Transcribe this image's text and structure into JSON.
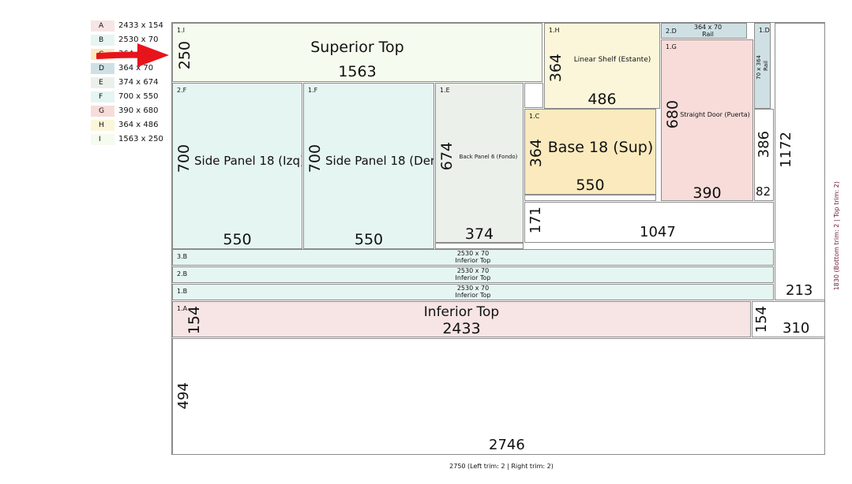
{
  "legend": [
    {
      "letter": "A",
      "dims": "2433 x 154",
      "color": "#f7e4e4"
    },
    {
      "letter": "B",
      "dims": "2530 x 70",
      "color": "#e5f5f2"
    },
    {
      "letter": "C",
      "dims": "364 x 550",
      "color": "#fbeabe"
    },
    {
      "letter": "D",
      "dims": "364 x 70",
      "color": "#cfe0e4"
    },
    {
      "letter": "E",
      "dims": "374 x 674",
      "color": "#ecf0eb"
    },
    {
      "letter": "F",
      "dims": "700 x 550",
      "color": "#e5f5f2"
    },
    {
      "letter": "G",
      "dims": "390 x 680",
      "color": "#f7dcd9"
    },
    {
      "letter": "H",
      "dims": "364 x 486",
      "color": "#fbf6d9"
    },
    {
      "letter": "I",
      "dims": "1563 x 250",
      "color": "#f5fbee"
    }
  ],
  "pieces": {
    "superior_top": {
      "code": "1.I",
      "name": "Superior Top",
      "width": "1563",
      "height": "250",
      "color": "#f5fbee"
    },
    "linear_shelf": {
      "code": "1.H",
      "name": "Linear Shelf (Estante)",
      "width": "486",
      "height": "364",
      "color": "#fbf6d9"
    },
    "rail_d2": {
      "code": "2.D",
      "dims": "364 x 70",
      "name": "Rail",
      "color": "#cfe0e4"
    },
    "rail_d1": {
      "code": "1.D",
      "dims": "70 x 364",
      "name": "Rail",
      "color": "#cfe0e4"
    },
    "straight_door": {
      "code": "1.G",
      "name": "Straight Door (Puerta)",
      "width": "390",
      "height": "680",
      "color": "#f7dcd9"
    },
    "side_panel_izq": {
      "code": "2.F",
      "name": "Side Panel 18 (Izq)",
      "width": "550",
      "height": "700",
      "color": "#e5f5f2"
    },
    "side_panel_der": {
      "code": "1.F",
      "name": "Side Panel 18 (Der)",
      "width": "550",
      "height": "700",
      "color": "#e5f5f2"
    },
    "back_panel": {
      "code": "1.E",
      "name": "Back Panel 6 (Fondo)",
      "width": "374",
      "height": "674",
      "color": "#ecf0eb"
    },
    "base_sup": {
      "code": "1.C",
      "name": "Base 18 (Sup)",
      "width": "550",
      "height": "364",
      "color": "#fbeabe"
    },
    "inferior_3b": {
      "code": "3.B",
      "dims": "2530 x 70",
      "name": "Inferior Top",
      "color": "#e5f5f2"
    },
    "inferior_2b": {
      "code": "2.B",
      "dims": "2530 x 70",
      "name": "Inferior Top",
      "color": "#e5f5f2"
    },
    "inferior_1b": {
      "code": "1.B",
      "dims": "2530 x 70",
      "name": "Inferior Top",
      "color": "#e5f5f2"
    },
    "inferior_top": {
      "code": "1.A",
      "name": "Inferior Top",
      "width": "2433",
      "height": "154",
      "color": "#f7e4e4"
    }
  },
  "waste": {
    "w1047": "1047",
    "h171": "171",
    "h386": "386",
    "w82": "82",
    "h1172": "1172",
    "w213": "213",
    "h154": "154",
    "w310": "310",
    "h494": "494",
    "w2746": "2746"
  },
  "axis": {
    "bottom": "2750 (Left trim: 2 | Right trim: 2)",
    "right": "1830 (Bottom trim: 2 | Top trim: 2)"
  },
  "arrow_color": "#e8141c"
}
